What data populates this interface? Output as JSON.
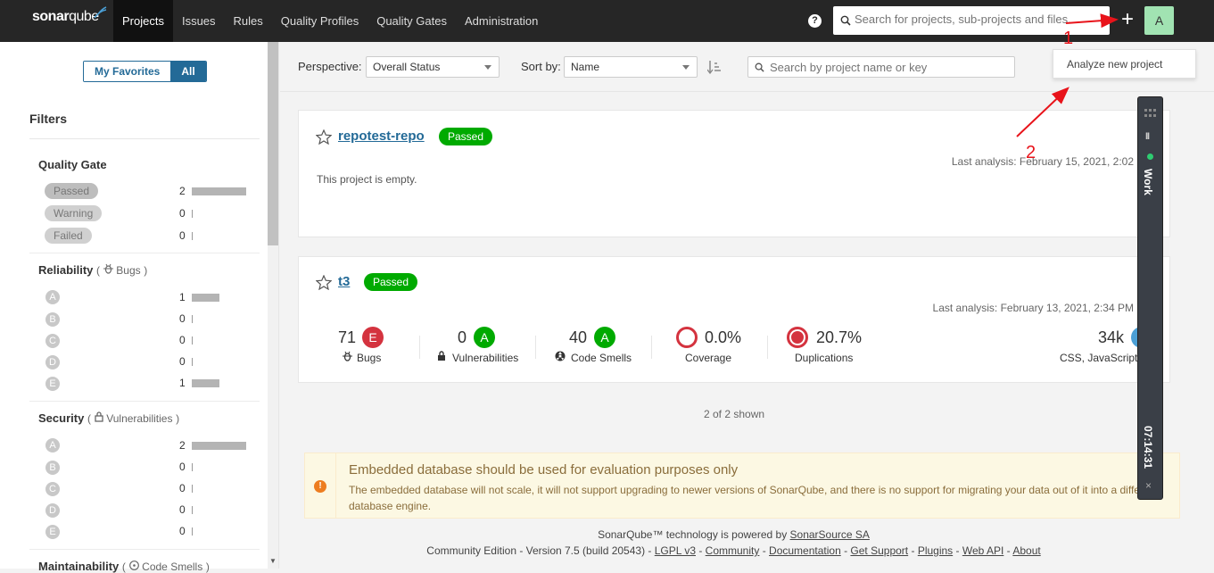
{
  "topbar": {
    "logo_text_a": "sonar",
    "logo_text_b": "qube",
    "nav": [
      "Projects",
      "Issues",
      "Rules",
      "Quality Profiles",
      "Quality Gates",
      "Administration"
    ],
    "help": "?",
    "search_placeholder": "Search for projects, sub-projects and files...",
    "plus": "+",
    "avatar": "A",
    "dropdown_item": "Analyze new project"
  },
  "sidebar": {
    "fav_toggle": {
      "favorites": "My Favorites",
      "all": "All"
    },
    "filters_title": "Filters",
    "quality_gate": {
      "title": "Quality Gate",
      "items": [
        {
          "label": "Passed",
          "count": "2",
          "fraction": 1.0
        },
        {
          "label": "Warning",
          "count": "0",
          "fraction": 0
        },
        {
          "label": "Failed",
          "count": "0",
          "fraction": 0
        }
      ]
    },
    "reliability": {
      "title": "Reliability",
      "paren_open": "(",
      "sub": "Bugs",
      "paren_close": ")",
      "items": [
        {
          "label": "A",
          "count": "1",
          "fraction": 0.5
        },
        {
          "label": "B",
          "count": "0",
          "fraction": 0
        },
        {
          "label": "C",
          "count": "0",
          "fraction": 0
        },
        {
          "label": "D",
          "count": "0",
          "fraction": 0
        },
        {
          "label": "E",
          "count": "1",
          "fraction": 0.5
        }
      ]
    },
    "security": {
      "title": "Security",
      "paren_open": "(",
      "sub": "Vulnerabilities",
      "paren_close": ")",
      "items": [
        {
          "label": "A",
          "count": "2",
          "fraction": 1.0
        },
        {
          "label": "B",
          "count": "0",
          "fraction": 0
        },
        {
          "label": "C",
          "count": "0",
          "fraction": 0
        },
        {
          "label": "D",
          "count": "0",
          "fraction": 0
        },
        {
          "label": "E",
          "count": "0",
          "fraction": 0
        }
      ]
    },
    "maintainability": {
      "title": "Maintainability",
      "paren_open": "(",
      "sub": "Code Smells",
      "paren_close": ")"
    }
  },
  "toolbar": {
    "perspective_label": "Perspective:",
    "perspective_value": "Overall Status",
    "sort_label": "Sort by:",
    "sort_value": "Name",
    "search_placeholder": "Search by project name or key"
  },
  "projects": [
    {
      "name": "repotest-repo",
      "status": "Passed",
      "last_analysis": "Last analysis: February 15, 2021, 2:02",
      "empty_text": "This project is empty."
    },
    {
      "name": "t3",
      "status": "Passed",
      "last_analysis": "Last analysis: February 13, 2021, 2:34 PM",
      "metrics": {
        "bugs": {
          "value": "71",
          "rating": "E",
          "label": "Bugs"
        },
        "vulnerabilities": {
          "value": "0",
          "rating": "A",
          "label": "Vulnerabilities"
        },
        "code_smells": {
          "value": "40",
          "rating": "A",
          "label": "Code Smells"
        },
        "coverage": {
          "value": "0.0%",
          "label": "Coverage"
        },
        "duplications": {
          "value": "20.7%",
          "label": "Duplications"
        },
        "size": {
          "value": "34k",
          "label": "CSS, JavaScript"
        }
      }
    }
  ],
  "shown": "2 of 2 shown",
  "banner": {
    "icon": "!",
    "title": "Embedded database should be used for evaluation purposes only",
    "text": "The embedded database will not scale, it will not support upgrading to newer versions of SonarQube, and there is no support for migrating your data out of it into a different database engine."
  },
  "footer": {
    "line1_prefix": "SonarQube™ technology is powered by ",
    "line1_link": "SonarSource SA",
    "edition": "Community Edition - Version 7.5 (build 20543) - ",
    "links": [
      "LGPL v3",
      "Community",
      "Documentation",
      "Get Support",
      "Plugins",
      "Web API",
      "About"
    ],
    "sep": " - "
  },
  "work_panel": {
    "label": "Work",
    "time": "07:14:31",
    "pause": "II",
    "close": "×"
  },
  "annotations": {
    "one": "1",
    "two": "2",
    "color": "#e8131a"
  },
  "colors": {
    "passed": "#00aa00",
    "rating_e": "#d4333f",
    "rating_a": "#00aa00",
    "link": "#236a97",
    "topbar": "#262626"
  }
}
